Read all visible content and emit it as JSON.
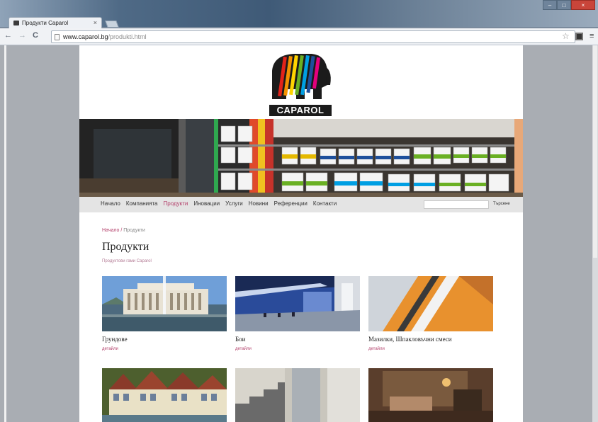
{
  "browser": {
    "tab_title": "Продукти Caparol",
    "tab_close": "×",
    "url_domain": "www.caparol.bg",
    "url_path": "/produkti.html",
    "back": "←",
    "forward": "→",
    "reload": "C",
    "star": "☆",
    "menu": "≡",
    "window_min": "–",
    "window_max": "□",
    "window_close": "×"
  },
  "site": {
    "logo_text": "CAPAROL",
    "nav": [
      {
        "label": "Начало"
      },
      {
        "label": "Компанията"
      },
      {
        "label": "Продукти",
        "active": true
      },
      {
        "label": "Иновации"
      },
      {
        "label": "Услуги"
      },
      {
        "label": "Новини"
      },
      {
        "label": "Референции"
      },
      {
        "label": "Контакти"
      }
    ],
    "search_button": "Търсене",
    "breadcrumb_home": "Начало",
    "breadcrumb_sep": "/",
    "breadcrumb_current": "Продукти",
    "page_title": "Продукти",
    "subtitle": "Продуктови гами Caparol",
    "products": [
      {
        "name": "Грундове",
        "link": "детайли"
      },
      {
        "name": "Бои",
        "link": "детайли"
      },
      {
        "name": "Мазилки, Шпакловъчни смеси",
        "link": "детайли"
      }
    ]
  },
  "colors": {
    "accent": "#b33f6a",
    "page_bg": "#ffffff",
    "nav_bg": "#e4e4e4"
  }
}
